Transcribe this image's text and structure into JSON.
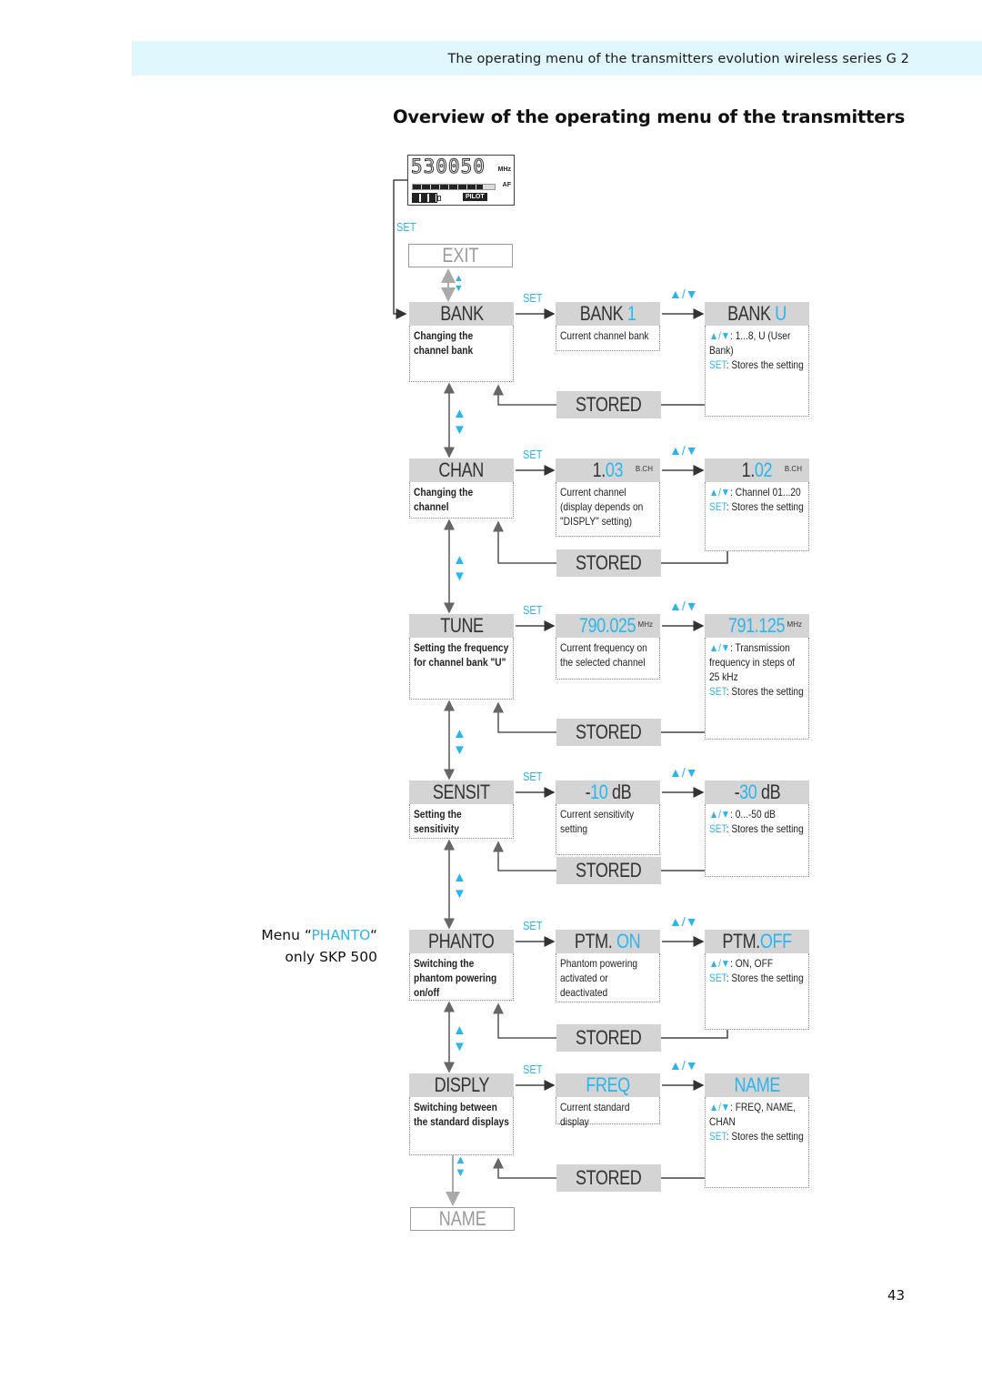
{
  "header": {
    "running_title": "The operating menu of the transmitters evolution wireless series G 2"
  },
  "page_title": "Overview of the operating menu of the transmitters",
  "lcd": {
    "frequency_digits": "530050",
    "mhz_label": "MHz",
    "af_label": "AF",
    "af_level": 0.85,
    "battery_bars": 3,
    "pilot_label": "PILOT"
  },
  "set_label": "SET",
  "updown_symbol": "▲/▼",
  "exit_box": "EXIT",
  "name_box": "NAME",
  "side_note": {
    "prefix": "Menu “",
    "highlight": "PHANTO",
    "suffix": "“",
    "line2": "only SKP 500"
  },
  "stored_label": "STORED",
  "menus": [
    {
      "name": "BANK",
      "description": "Changing the channel bank",
      "current": {
        "main": "BANK",
        "value": " 1",
        "unit": ""
      },
      "current_desc": "Current channel bank",
      "edit": {
        "main": "BANK",
        "value": " U",
        "unit": ""
      },
      "edit_range": ": 1...8, U (User Bank)",
      "edit_set": ": Stores the setting"
    },
    {
      "name": "CHAN",
      "description": "Changing the channel",
      "current": {
        "main": "1.",
        "value": "03",
        "unit": "B.CH"
      },
      "current_desc": "Current channel (display depends on \"DISPLY\" setting)",
      "edit": {
        "main": "1.",
        "value": "02",
        "unit": "B.CH"
      },
      "edit_range": ": Channel  01...20",
      "edit_set": ": Stores the setting"
    },
    {
      "name": "TUNE",
      "description": "Setting the frequency for channel bank \"U\"",
      "current": {
        "main": "",
        "value": "790.025",
        "unit": "MHz"
      },
      "current_desc": "Current frequency on the selected channel",
      "edit": {
        "main": "",
        "value": "791.125",
        "unit": "MHz"
      },
      "edit_range": ": Transmission frequency in steps of 25 kHz",
      "edit_set": ": Stores the setting"
    },
    {
      "name": "SENSIT",
      "description": "Setting the sensitivity",
      "current": {
        "main": "-",
        "value": "10",
        "suffix": " dB",
        "unit": ""
      },
      "current_desc": "Current sensitivity setting",
      "edit": {
        "main": "-",
        "value": "30",
        "suffix": " dB",
        "unit": ""
      },
      "edit_range": ":  0...-50 dB",
      "edit_set": ": Stores the setting"
    },
    {
      "name": "PHANTO",
      "description": "Switching the phantom powering on/off",
      "current": {
        "main": "PTM. ",
        "value": "ON",
        "unit": ""
      },
      "current_desc": "Phantom powering activated or deactivated",
      "edit": {
        "main": "PTM.",
        "value": "OFF",
        "unit": ""
      },
      "edit_range": ": ON, OFF",
      "edit_set": ": Stores the setting"
    },
    {
      "name": "DISPLY",
      "description": "Switching between the standard displays",
      "current": {
        "main": "",
        "value": "FREQ",
        "unit": ""
      },
      "current_desc": "Current standard display",
      "edit": {
        "main": "",
        "value": "NAME",
        "unit": ""
      },
      "edit_range": ":  FREQ, NAME, CHAN",
      "edit_set": ": Stores the setting"
    }
  ],
  "page_number": "43",
  "colors": {
    "accent_blue": "#29b6ef",
    "header_band": "#dff6fd",
    "menu_grey": "#d4d4d5"
  }
}
